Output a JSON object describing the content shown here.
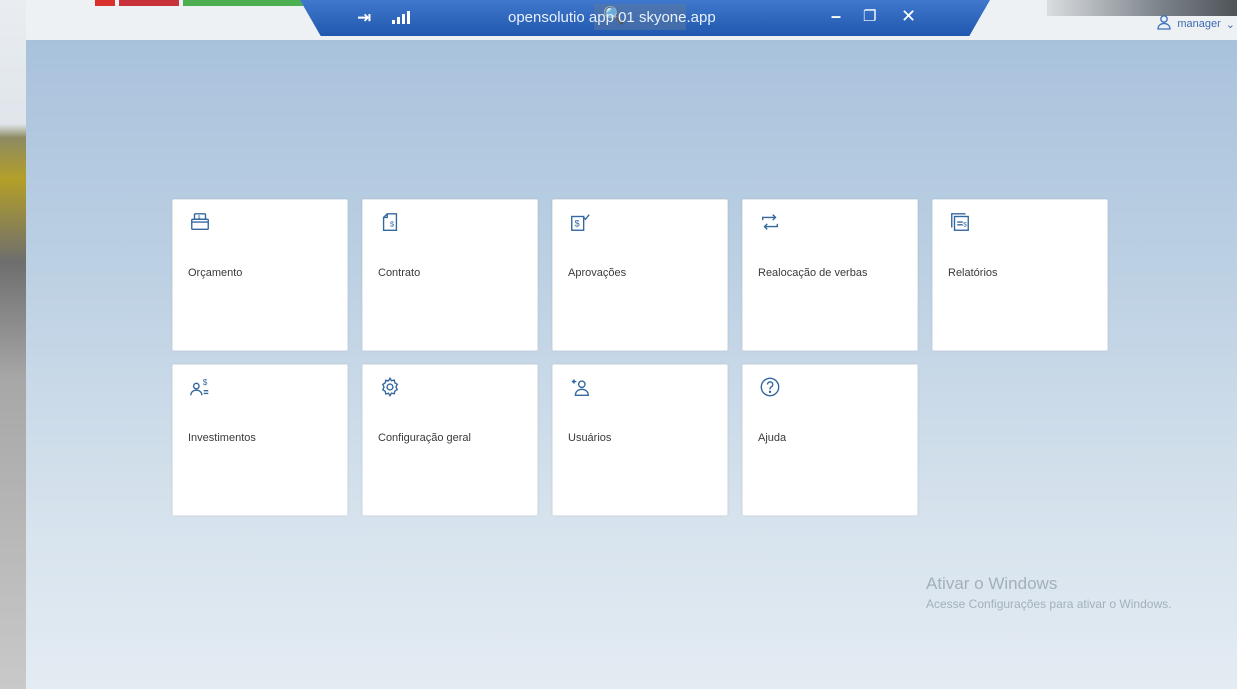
{
  "remote_bar": {
    "host": "opensolutio app 01 skyone.app",
    "pin_icon": "pin-icon",
    "signal_icon": "signal-bars-icon",
    "zoom_icon": "zoom-icon",
    "minimize_icon": "minimize-icon",
    "restore_icon": "restore-icon",
    "close_icon": "close-icon"
  },
  "user_menu": {
    "username": "manager",
    "icon": "user-icon"
  },
  "tiles": [
    {
      "label": "Orçamento",
      "icon": "budget-wallet-icon"
    },
    {
      "label": "Contrato",
      "icon": "contract-document-icon"
    },
    {
      "label": "Aprovações",
      "icon": "approval-check-icon"
    },
    {
      "label": "Realocação de verbas",
      "icon": "reallocate-arrows-icon"
    },
    {
      "label": "Relatórios",
      "icon": "reports-icon"
    },
    {
      "label": "Investimentos",
      "icon": "investments-user-icon"
    },
    {
      "label": "Configuração geral",
      "icon": "gear-icon"
    },
    {
      "label": "Usuários",
      "icon": "user-settings-icon"
    },
    {
      "label": "Ajuda",
      "icon": "help-icon"
    }
  ],
  "watermark": {
    "title": "Ativar o Windows",
    "subtitle": "Acesse Configurações para ativar o Windows."
  },
  "colors": {
    "accent": "#34679f",
    "remote_bar": "#1f58ae",
    "background": "#b4c9df"
  }
}
